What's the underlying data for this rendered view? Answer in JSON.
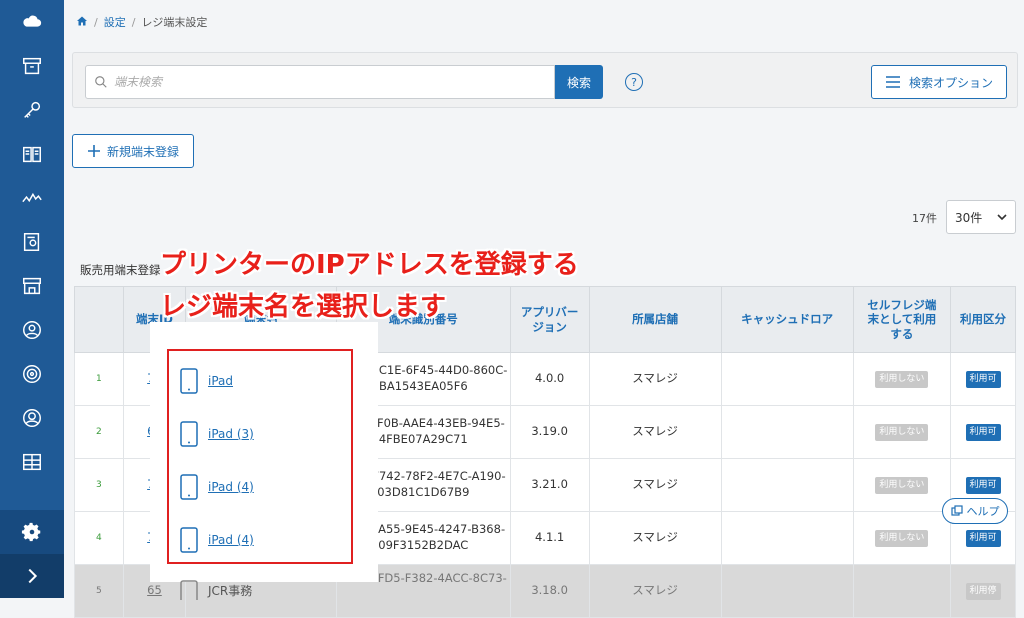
{
  "breadcrumb": {
    "settings": "設定",
    "current": "レジ端末設定"
  },
  "search": {
    "placeholder": "端末検索",
    "button": "検索",
    "help": "?",
    "options_button": "検索オプション"
  },
  "new_button": "新規端末登録",
  "pagination": {
    "count": "17件",
    "per_page": "30件"
  },
  "tab_label": "販売用端末登録",
  "table": {
    "headers": [
      "",
      "端末ID",
      "端末名",
      "端末識別番号",
      "アプリバー\nジョン",
      "所属店舗",
      "キャッシュドロア",
      "セルフレジ端\n末として利用\nする",
      "利用区分"
    ],
    "rows": [
      {
        "no": "1",
        "id": "75",
        "name": "iPad",
        "uuid1": "0D2D2C1E-6F45-44D0-860C-",
        "uuid2": "BA1543EA05F6",
        "version": "4.0.0",
        "store": "スマレジ",
        "self": "利用しない",
        "status": "利用可"
      },
      {
        "no": "2",
        "id": "64",
        "name": "iPad (3)",
        "uuid1": "FF169F0B-AAE4-43EB-94E5-",
        "uuid2": "4FBE07A29C71",
        "version": "3.19.0",
        "store": "スマレジ",
        "self": "利用しない",
        "status": "利用可"
      },
      {
        "no": "3",
        "id": "70",
        "name": "iPad (4)",
        "uuid1": "A5D5F742-78F2-4E7C-A190-",
        "uuid2": "03D81C1D67B9",
        "version": "3.21.0",
        "store": "スマレジ",
        "self": "利用しない",
        "status": "利用可"
      },
      {
        "no": "4",
        "id": "76",
        "name": "iPad (4)",
        "uuid1": "66941A55-9E45-4247-B368-",
        "uuid2": "09F3152B2DAC",
        "version": "4.1.1",
        "store": "スマレジ",
        "self": "利用しない",
        "status": "利用可"
      },
      {
        "no": "5",
        "id": "65",
        "name": "JCR事務",
        "uuid1": "C49C1FD5-F382-4ACC-8C73-",
        "uuid2": "",
        "version": "3.18.0",
        "store": "スマレジ",
        "self": "",
        "status": "利用停"
      }
    ]
  },
  "annotation": {
    "line1": "プリンターのIPアドレスを登録する",
    "line2": "レジ端末名を選択します"
  },
  "help_float": "ヘルプ",
  "colors": {
    "sidebar": "#1f5a96",
    "accent": "#1f6fb5",
    "annotation": "#e8201a"
  }
}
